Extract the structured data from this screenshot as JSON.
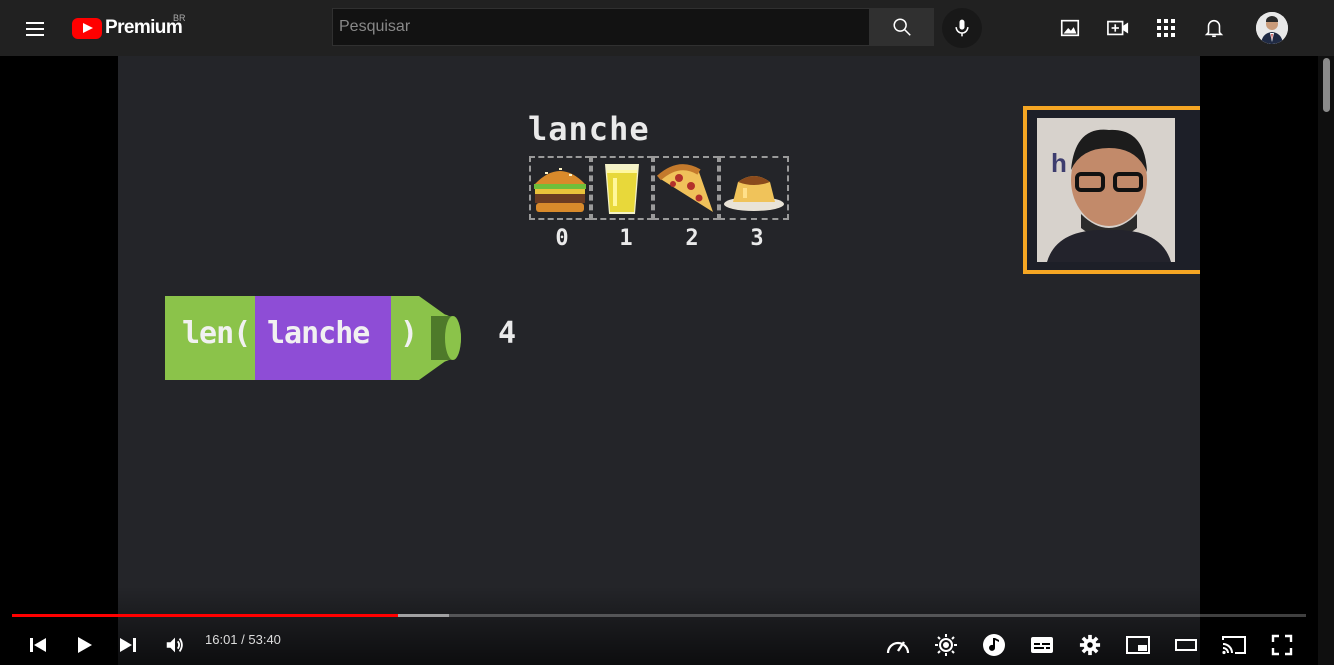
{
  "header": {
    "logo_text": "Premium",
    "logo_region": "BR",
    "search": {
      "placeholder": "Pesquisar",
      "value": ""
    },
    "icons": [
      "menu-icon",
      "search-icon",
      "mic-icon",
      "image-icon",
      "create-video-icon",
      "apps-grid-icon",
      "notifications-bell-icon",
      "avatar"
    ]
  },
  "video": {
    "list_name": "lanche",
    "items": [
      {
        "index": "0",
        "icon": "hamburger-icon"
      },
      {
        "index": "1",
        "icon": "juice-glass-icon"
      },
      {
        "index": "2",
        "icon": "pizza-slice-icon"
      },
      {
        "index": "3",
        "icon": "pudding-icon"
      }
    ],
    "code_func": "len(",
    "code_arg": "lanche",
    "code_close": ")",
    "result": "4",
    "webcam_partial_text": "h"
  },
  "player": {
    "current_time": "16:01",
    "duration": "53:40",
    "time_display": "16:01 / 53:40",
    "played_fraction": 0.298,
    "buffered_fraction": 0.338,
    "colors": {
      "progress": "#ff0000",
      "accent_orange": "#f5a623",
      "len_green": "#8bc34a",
      "arg_purple": "#8e4dd6"
    }
  }
}
